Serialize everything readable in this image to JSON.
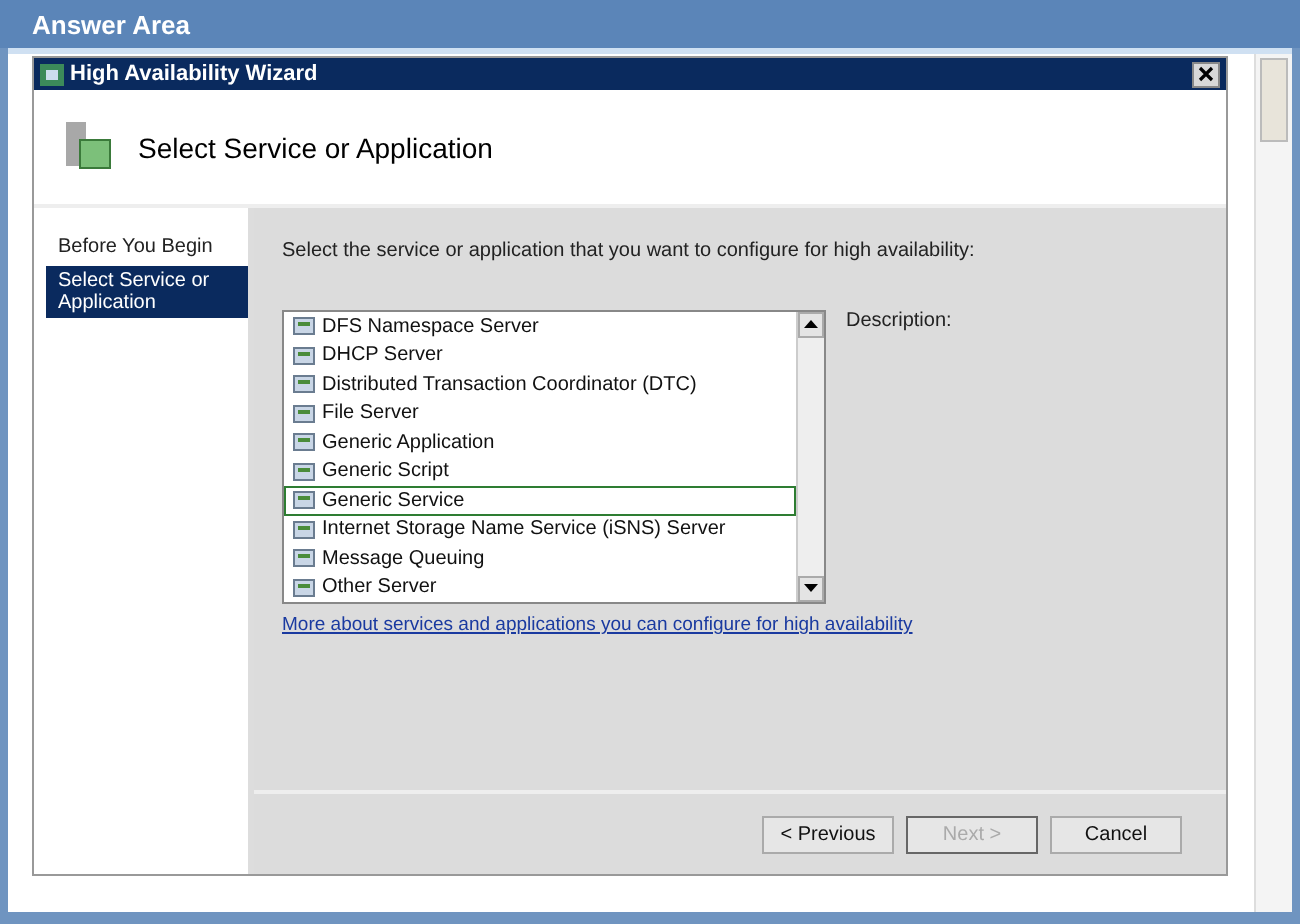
{
  "header": {
    "title": "Answer Area"
  },
  "dialog": {
    "title": "High Availability Wizard",
    "heading": "Select Service or Application"
  },
  "nav": [
    {
      "label": "Before You Begin",
      "selected": false
    },
    {
      "label": "Select Service or Application",
      "selected": true
    }
  ],
  "instruction": "Select the service or application that you want to configure for high availability:",
  "services": [
    {
      "label": "DFS Namespace Server",
      "selected": false
    },
    {
      "label": "DHCP Server",
      "selected": false
    },
    {
      "label": "Distributed Transaction Coordinator (DTC)",
      "selected": false
    },
    {
      "label": "File Server",
      "selected": false
    },
    {
      "label": "Generic Application",
      "selected": false
    },
    {
      "label": "Generic Script",
      "selected": false
    },
    {
      "label": "Generic Service",
      "selected": true
    },
    {
      "label": "Internet Storage Name Service (iSNS) Server",
      "selected": false
    },
    {
      "label": "Message Queuing",
      "selected": false
    },
    {
      "label": "Other Server",
      "selected": false
    }
  ],
  "description_label": "Description:",
  "link": "More about services and applications you can configure for high availability",
  "buttons": [
    {
      "label": "< Previous",
      "disabled": false
    },
    {
      "label": "Next >",
      "disabled": true
    },
    {
      "label": "Cancel",
      "disabled": false
    }
  ]
}
